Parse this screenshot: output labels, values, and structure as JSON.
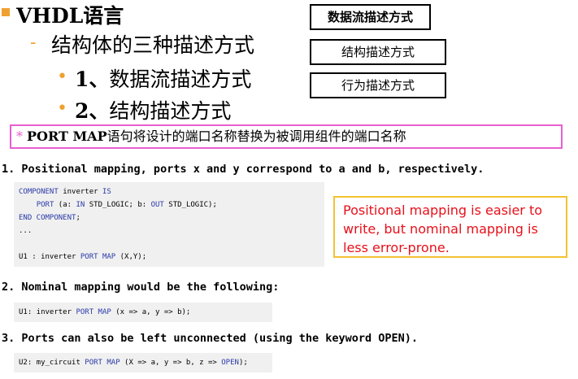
{
  "header": {
    "title_prefix": "VHDL",
    "title_suffix": "语言",
    "subtitle": "结构体的三种描述方式",
    "item1_num": "1、",
    "item1_text": "数据流描述方式",
    "item2_num": "2、",
    "item2_text": "结构描述方式"
  },
  "boxes": {
    "dataflow": "数据流描述方式",
    "structural": "结构描述方式",
    "behavioral": "行为描述方式"
  },
  "port_map_note": {
    "star": "*",
    "keyword": "PORT MAP",
    "text": "语句将设计的端口名称替换为被调用组件的端口名称"
  },
  "points": {
    "p1": "1. Positional mapping, ports x and y correspond to a and b, respectively.",
    "p2": "2. Nominal mapping would be the following:",
    "p3": "3. Ports can also be left unconnected (using the keyword OPEN)."
  },
  "code1": {
    "l1_kw": "COMPONENT",
    "l1_rest": " inverter ",
    "l1_kw2": "IS",
    "l2_pre": "    ",
    "l2_kw": "PORT",
    "l2_a": " (a: ",
    "l2_in": "IN",
    "l2_b": " STD_LOGIC; b: ",
    "l2_out": "OUT",
    "l2_c": " STD_LOGIC);",
    "l3_kw": "END COMPONENT",
    "l3_rest": ";",
    "l4": "...",
    "l5": "",
    "l6_a": "U1 : inverter ",
    "l6_kw": "PORT MAP",
    "l6_b": " (X,Y);"
  },
  "code2": {
    "a": "U1: inverter ",
    "kw": "PORT MAP",
    "b": " (x => a, y => b);"
  },
  "code3": {
    "a": "U2: my_circuit ",
    "kw": "PORT MAP",
    "b": " (X => a, y => b, z => ",
    "kw2": "OPEN",
    "c": ");"
  },
  "note": "Positional mapping is easier to write, but nominal mapping is less error-prone."
}
